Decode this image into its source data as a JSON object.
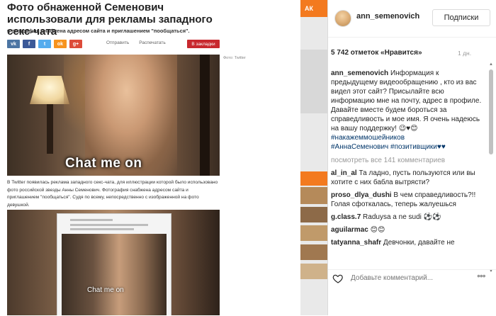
{
  "article": {
    "title": "Фото обнаженной Семенович использовали для рекламы западного секс-чата",
    "subtitle": "Фотография снабжена адресом сайта и приглашением \"пообщаться\".",
    "share_buttons": [
      {
        "label": "vk",
        "color": "#4c75a3"
      },
      {
        "label": "f",
        "color": "#3b5998"
      },
      {
        "label": "t",
        "color": "#55acee"
      },
      {
        "label": "ok",
        "color": "#f7931e"
      },
      {
        "label": "g+",
        "color": "#dd4b39"
      }
    ],
    "actions": [
      "Отправить",
      "Распечатать"
    ],
    "bookmark_label": "В закладки",
    "photo_credit": "Фото: Twitter",
    "overlay_text": "Chat me on",
    "body_text": "В Twitter появилась реклама западного секс-чата, для иллюстрации которой было использовано фото российской звезды Анны Семенович. Фотография снабжена адресом сайта и приглашением \"пообщаться\". Судя по всему, непосредственно с изображенной на фото девушкой.",
    "overlay_text_small": "Chat me on"
  },
  "ad_strip": {
    "top_label": "АК"
  },
  "instagram": {
    "username": "ann_semenovich",
    "follow_label": "Подписки",
    "likes": "5 742 отметок «Нравится»",
    "age": "1 дн.",
    "caption_user": "ann_semenovich",
    "caption_text": "Информация к предыдущему видеообращению , кто из вас видел этот сайт? Присылайте всю информацию мне на почту, адрес в профиле. Давайте вместе будем бороться за справедливость и мое имя. Я очень надеюсь на вашу поддержку! 😉♥😊",
    "tags": [
      "#накажеммошейников",
      "#АннаСеменович",
      "#позитивщики♥♥"
    ],
    "view_all": "посмотреть все 141 комментариев",
    "comments": [
      {
        "user": "al_in_al",
        "text": "Та ладно, пусть пользуются или вы хотите с них бабла вытрясти?"
      },
      {
        "user": "proso_dlya_dushi",
        "text": "В чем справедливость?!! Голая сфоткалась, теперь жалуешься"
      },
      {
        "user": "g.class.7",
        "text": "Raduysa a ne sudi ⚽⚽"
      },
      {
        "user": "aguilarmac",
        "text": "😊😊"
      },
      {
        "user": "tatyanna_shafr",
        "text": "Девчонки, давайте не"
      }
    ],
    "comment_placeholder": "Добавьте комментарий...",
    "more_label": "•••",
    "heart_icon": "heart-icon",
    "accent_link_color": "#003569"
  }
}
